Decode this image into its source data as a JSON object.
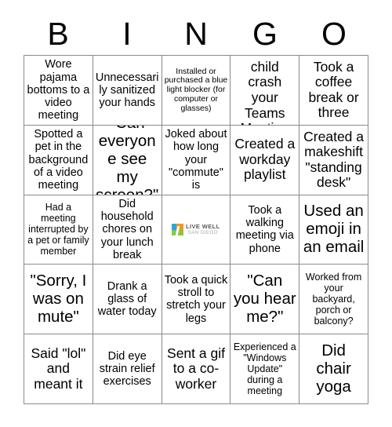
{
  "card": {
    "title": "BINGO",
    "header_letters": [
      "B",
      "I",
      "N",
      "G",
      "O"
    ],
    "columns": 5,
    "rows": 5,
    "grid_border_color": "#8a8a8a",
    "background_color": "#ffffff",
    "text_color": "#000000"
  },
  "free_space": {
    "logo_line1": "LIVE WELL",
    "logo_line2": "SAN DIEGO",
    "icon_name": "live-well-san-diego-logo",
    "colors": {
      "orange": "#f7941e",
      "green": "#8dc63f",
      "blue": "#27aae1",
      "line1_gray": "#58595b",
      "line2_gray": "#a7a9ac"
    }
  },
  "cells": [
    {
      "row": 1,
      "col": 1,
      "column_letter": "B",
      "text": "Wore pajama bottoms to a video meeting",
      "size": "fs-md"
    },
    {
      "row": 1,
      "col": 2,
      "column_letter": "I",
      "text": "Unnecessarily sanitized your hands",
      "size": "fs-md"
    },
    {
      "row": 1,
      "col": 3,
      "column_letter": "N",
      "text": "Installed or purchased a blue light blocker (for computer or glasses)",
      "size": "fs-xs"
    },
    {
      "row": 1,
      "col": 4,
      "column_letter": "G",
      "text": "Had a child crash your Teams Meeting",
      "size": "fs-lg"
    },
    {
      "row": 1,
      "col": 5,
      "column_letter": "O",
      "text": "Took a coffee break or three",
      "size": "fs-lg"
    },
    {
      "row": 2,
      "col": 1,
      "column_letter": "B",
      "text": "Spotted a pet in the background of a video meeting",
      "size": "fs-md"
    },
    {
      "row": 2,
      "col": 2,
      "column_letter": "I",
      "text": "\"Can everyone see my screen?\"",
      "size": "fs-xl"
    },
    {
      "row": 2,
      "col": 3,
      "column_letter": "N",
      "text": "Joked about how long your \"commute\" is",
      "size": "fs-md"
    },
    {
      "row": 2,
      "col": 4,
      "column_letter": "G",
      "text": "Created a workday playlist",
      "size": "fs-lg"
    },
    {
      "row": 2,
      "col": 5,
      "column_letter": "O",
      "text": "Created a makeshift \"standing desk\"",
      "size": "fs-lg"
    },
    {
      "row": 3,
      "col": 1,
      "column_letter": "B",
      "text": "Had a meeting interrupted by a pet or family member",
      "size": "fs-sm"
    },
    {
      "row": 3,
      "col": 2,
      "column_letter": "I",
      "text": "Did household chores on your lunch break",
      "size": "fs-md"
    },
    {
      "row": 3,
      "col": 3,
      "column_letter": "N",
      "text": "",
      "size": "fs-md",
      "is_free_space": true
    },
    {
      "row": 3,
      "col": 4,
      "column_letter": "G",
      "text": "Took a walking meeting via phone",
      "size": "fs-md"
    },
    {
      "row": 3,
      "col": 5,
      "column_letter": "O",
      "text": "Used an emoji in an email",
      "size": "fs-xl"
    },
    {
      "row": 4,
      "col": 1,
      "column_letter": "B",
      "text": "\"Sorry, I was on mute\"",
      "size": "fs-xl"
    },
    {
      "row": 4,
      "col": 2,
      "column_letter": "I",
      "text": "Drank a glass of water today",
      "size": "fs-md"
    },
    {
      "row": 4,
      "col": 3,
      "column_letter": "N",
      "text": "Took a quick stroll to stretch your legs",
      "size": "fs-md"
    },
    {
      "row": 4,
      "col": 4,
      "column_letter": "G",
      "text": "\"Can you hear me?\"",
      "size": "fs-xl"
    },
    {
      "row": 4,
      "col": 5,
      "column_letter": "O",
      "text": "Worked from your backyard, porch or balcony?",
      "size": "fs-sm"
    },
    {
      "row": 5,
      "col": 1,
      "column_letter": "B",
      "text": "Said \"lol\" and meant it",
      "size": "fs-lg"
    },
    {
      "row": 5,
      "col": 2,
      "column_letter": "I",
      "text": "Did eye strain relief exercises",
      "size": "fs-md"
    },
    {
      "row": 5,
      "col": 3,
      "column_letter": "N",
      "text": "Sent a gif to a co-worker",
      "size": "fs-lg"
    },
    {
      "row": 5,
      "col": 4,
      "column_letter": "G",
      "text": "Experienced a \"Windows Update\" during a meeting",
      "size": "fs-sm"
    },
    {
      "row": 5,
      "col": 5,
      "column_letter": "O",
      "text": "Did chair yoga",
      "size": "fs-xl"
    }
  ]
}
